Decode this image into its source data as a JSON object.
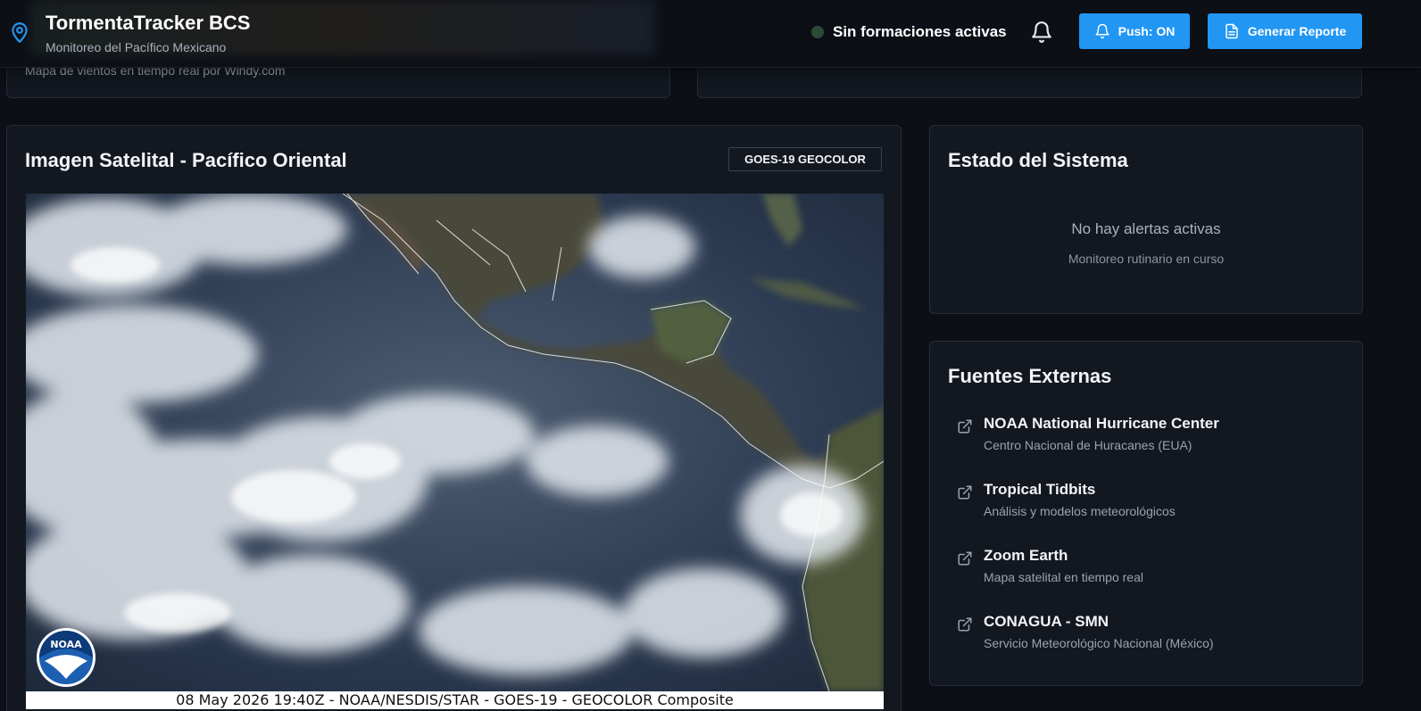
{
  "header": {
    "title": "TormentaTracker BCS",
    "subtitle": "Monitoreo del Pacífico Mexicano",
    "status_text": "Sin formaciones activas",
    "push_label": "Push: ON",
    "report_label": "Generar Reporte",
    "icons": [
      "map-pin-icon",
      "bell-icon",
      "file-text-icon"
    ],
    "accent_color": "#2196f3"
  },
  "top_cards": {
    "wind_caption": "Mapa de vientos en tiempo real por Windy.com"
  },
  "satellite": {
    "title": "Imagen Satelital - Pacífico Oriental",
    "badge": "GOES-19 GEOCOLOR",
    "caption": "08 May 2026 19:40Z - NOAA/NESDIS/STAR - GOES-19 - GEOCOLOR Composite",
    "logo_text": "NOAA"
  },
  "system_status": {
    "title": "Estado del Sistema",
    "message": "No hay alertas activas",
    "detail": "Monitoreo rutinario en curso"
  },
  "sources": {
    "title": "Fuentes Externas",
    "items": [
      {
        "name": "NOAA National Hurricane Center",
        "desc": "Centro Nacional de Huracanes (EUA)"
      },
      {
        "name": "Tropical Tidbits",
        "desc": "Análisis y modelos meteorológicos"
      },
      {
        "name": "Zoom Earth",
        "desc": "Mapa satelital en tiempo real"
      },
      {
        "name": "CONAGUA - SMN",
        "desc": "Servicio Meteorológico Nacional (México)"
      }
    ]
  }
}
